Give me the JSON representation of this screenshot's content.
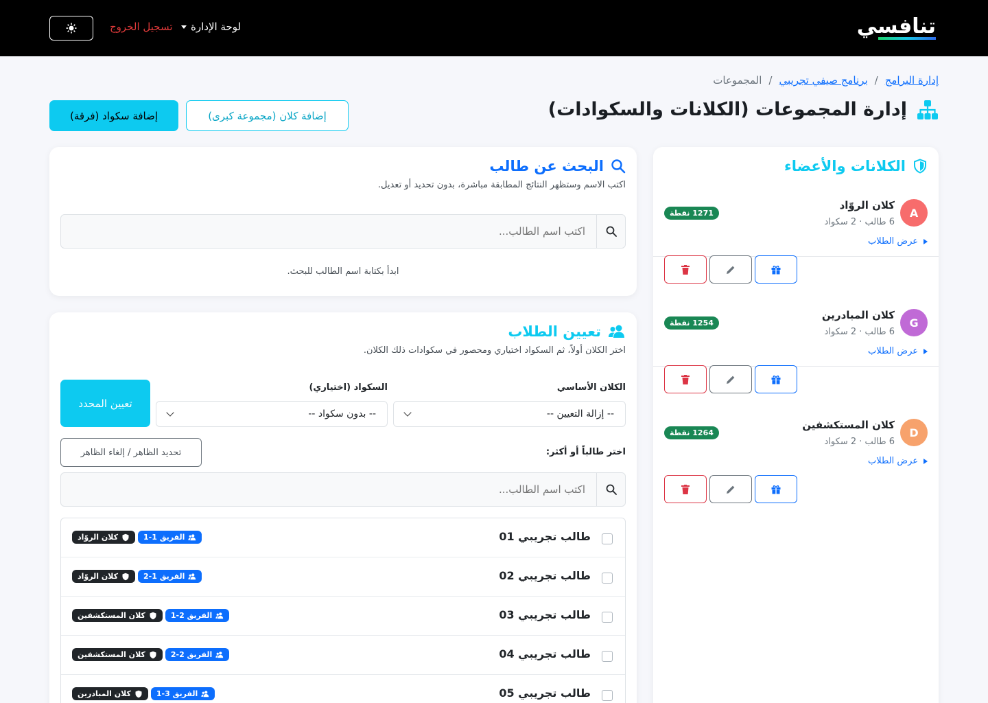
{
  "navbar": {
    "logo_text": "تنافسي",
    "admin_label": "لوحة الإدارة",
    "logout_label": "تسجيل الخروج",
    "theme_icon": "sun-icon"
  },
  "breadcrumb": {
    "items": [
      "إدارة البرامج",
      "برنامج صيفي تجريبي"
    ],
    "current": "المجموعات"
  },
  "header": {
    "title": "إدارة المجموعات (الكلانات والسكوادات)",
    "add_clan_label": "إضافة كلان (مجموعة كبرى)",
    "add_squad_label": "إضافة سكواد (فرقة)"
  },
  "clans_panel": {
    "title": "الكلانات والأعضاء",
    "clans": [
      {
        "initial": "A",
        "color": "#f76c6c",
        "name": "كلان الروّاد",
        "meta": "6 طالب · 2 سكواد",
        "toggle": "عرض الطلاب",
        "points": "1271 نقطة"
      },
      {
        "initial": "G",
        "color": "#c06ad6",
        "name": "كلان المبادرين",
        "meta": "6 طالب · 2 سكواد",
        "toggle": "عرض الطلاب",
        "points": "1254 نقطة"
      },
      {
        "initial": "D",
        "color": "#f7a26c",
        "name": "كلان المستكشفين",
        "meta": "6 طالب · 2 سكواد",
        "toggle": "عرض الطلاب",
        "points": "1264 نقطة"
      }
    ]
  },
  "search_panel": {
    "title": "البحث عن طالب",
    "description": "اكتب الاسم وستظهر النتائج المطابقة مباشرة، بدون تحديد أو تعديل.",
    "placeholder": "اكتب اسم الطالب...",
    "hint": "ابدأ بكتابة اسم الطالب للبحث."
  },
  "assign_panel": {
    "title": "تعيين الطلاب",
    "description": "اختر الكلان أولاً، ثم السكواد اختياري ومحصور في سكوادات ذلك الكلان.",
    "clan_label": "الكلان الأساسي",
    "clan_value": "-- إزالة التعيين --",
    "squad_label": "السكواد (اختياري)",
    "squad_value": "-- بدون سكواد --",
    "assign_button": "تعيين المحدد",
    "pick_label": "اختر طالباً أو أكثر:",
    "toggle_visible": "تحديد الظاهر / إلغاء الظاهر",
    "placeholder": "اكتب اسم الطالب...",
    "students": [
      {
        "name": "طالب تجريبي 01",
        "clan": "كلان الروّاد",
        "squad": "الفريق 1-1"
      },
      {
        "name": "طالب تجريبي 02",
        "clan": "كلان الروّاد",
        "squad": "الفريق 1-2"
      },
      {
        "name": "طالب تجريبي 03",
        "clan": "كلان المستكشفين",
        "squad": "الفريق 2-1"
      },
      {
        "name": "طالب تجريبي 04",
        "clan": "كلان المستكشفين",
        "squad": "الفريق 2-2"
      },
      {
        "name": "طالب تجريبي 05",
        "clan": "كلان المبادرين",
        "squad": "الفريق 3-1"
      }
    ]
  }
}
